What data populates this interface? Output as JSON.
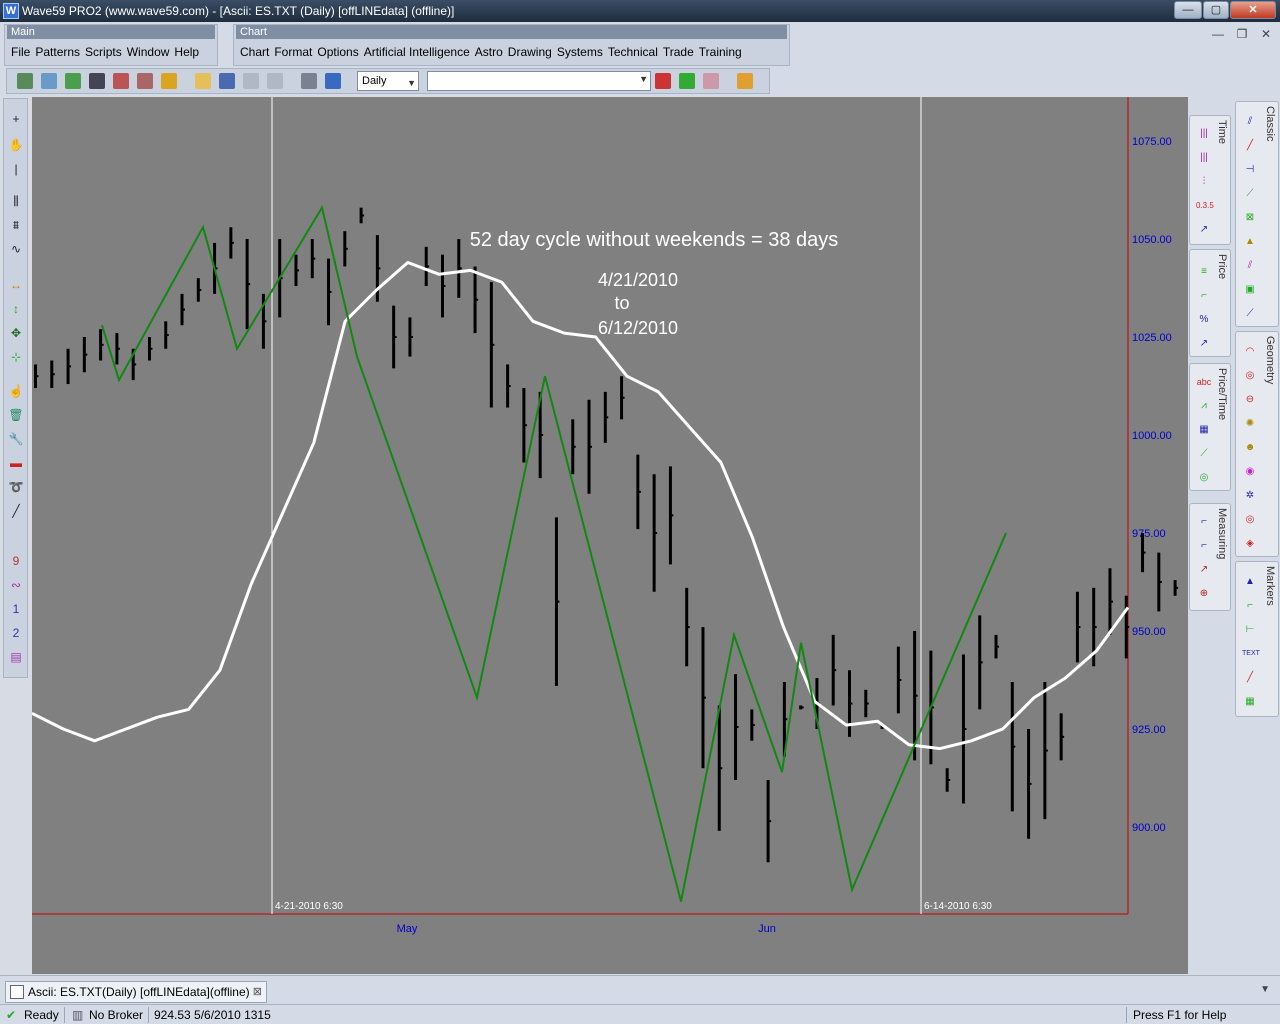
{
  "window": {
    "title": "Wave59 PRO2 (www.wave59.com) - [Ascii: ES.TXT (Daily) [offLINEdata] (offline)]",
    "app_icon": "W",
    "minimize": "—",
    "maximize": "▢",
    "close": "✕"
  },
  "menus": {
    "main": {
      "title": "Main",
      "items": [
        "File",
        "Patterns",
        "Scripts",
        "Window",
        "Help"
      ]
    },
    "chart": {
      "title": "Chart",
      "items": [
        "Chart",
        "Format",
        "Options",
        "Artificial Intelligence",
        "Astro",
        "Drawing",
        "Systems",
        "Technical",
        "Trade",
        "Training"
      ]
    }
  },
  "mdi_controls": {
    "minimize": "—",
    "restore": "❐",
    "close": "✕"
  },
  "toolbar": {
    "timeframe": "Daily",
    "symbol": ""
  },
  "chart": {
    "annotation": "52 day cycle without weekends = 38 days",
    "date_from": "4/21/2010",
    "date_to_word": "to",
    "date_to": "6/12/2010",
    "vline1_label": "4-21-2010 6:30",
    "vline2_label": "6-14-2010 6:30",
    "month_labels": [
      "May",
      "Jun"
    ],
    "price_labels": [
      "1075.00",
      "1050.00",
      "1025.00",
      "1000.00",
      "975.00",
      "950.00",
      "925.00",
      "900.00"
    ],
    "colors": {
      "background": "#808080",
      "bars": "#000000",
      "zigzag": "#118811",
      "cycle_line": "#ffffff",
      "axis": "#cc0000",
      "price_text": "#0000cc"
    }
  },
  "chart_data": {
    "type": "ohlc",
    "title": "",
    "xlabel": "",
    "ylabel": "",
    "ylim": [
      880,
      1085
    ],
    "categories": [],
    "series": [
      {
        "values": [
          [
            1018,
            1012
          ],
          [
            1019,
            1012
          ],
          [
            1022,
            1013
          ],
          [
            1025,
            1016
          ],
          [
            1027,
            1019
          ],
          [
            1026,
            1018
          ],
          [
            1022,
            1014
          ],
          [
            1025,
            1019
          ],
          [
            1029,
            1022
          ],
          [
            1036,
            1028
          ],
          [
            1040,
            1034
          ],
          [
            1049,
            1036
          ],
          [
            1053,
            1045
          ],
          [
            1050,
            1027
          ],
          [
            1036,
            1022
          ],
          [
            1050,
            1030
          ],
          [
            1046,
            1038
          ],
          [
            1050,
            1040
          ],
          [
            1045,
            1028
          ],
          [
            1052,
            1043
          ],
          [
            1058,
            1054
          ],
          [
            1051,
            1034
          ],
          [
            1033,
            1017
          ],
          [
            1030,
            1020
          ],
          [
            1048,
            1038
          ],
          [
            1046,
            1030
          ],
          [
            1050,
            1035
          ],
          [
            1043,
            1026
          ],
          [
            1039,
            1007
          ],
          [
            1018,
            1007
          ],
          [
            1012,
            993
          ],
          [
            1011,
            989
          ],
          [
            979,
            936
          ],
          [
            1004,
            990
          ],
          [
            1009,
            985
          ],
          [
            1011,
            998
          ],
          [
            1015,
            1004
          ],
          [
            995,
            976
          ],
          [
            990,
            960
          ],
          [
            992,
            967
          ],
          [
            961,
            941
          ],
          [
            951,
            915
          ],
          [
            931,
            899
          ],
          [
            939,
            912
          ],
          [
            930,
            922
          ],
          [
            912,
            891
          ],
          [
            937,
            918
          ],
          [
            931,
            930
          ],
          [
            938,
            925
          ],
          [
            949,
            931
          ],
          [
            940,
            923
          ],
          [
            935,
            928
          ],
          [
            926,
            925
          ],
          [
            946,
            929
          ],
          [
            950,
            917
          ],
          [
            945,
            916
          ],
          [
            915,
            909
          ],
          [
            944,
            906
          ],
          [
            954,
            930
          ],
          [
            949,
            943
          ],
          [
            937,
            904
          ],
          [
            925,
            897
          ],
          [
            937,
            902
          ],
          [
            929,
            917
          ],
          [
            960,
            942
          ],
          [
            961,
            941
          ],
          [
            966,
            949
          ],
          [
            959,
            943
          ],
          [
            975,
            965
          ],
          [
            970,
            955
          ],
          [
            963,
            959
          ],
          [
            955,
            946
          ],
          [
            944,
            926
          ],
          [
            929,
            914
          ],
          [
            924,
            909
          ],
          [
            928,
            915
          ],
          [
            906,
            888
          ],
          [
            890,
            878
          ]
        ]
      }
    ],
    "zigzag": [
      1028,
      1014,
      1053,
      1022,
      1058,
      1020,
      933,
      1015,
      881,
      949,
      914,
      947,
      884,
      975
    ],
    "cycle_overlay": [
      929,
      925,
      922,
      925,
      928,
      930,
      940,
      962,
      980,
      998,
      1029,
      1037,
      1044,
      1041,
      1042,
      1039,
      1029,
      1026,
      1025,
      1015,
      1011,
      1002,
      993,
      974,
      951,
      932,
      926,
      927,
      921,
      920,
      922,
      925,
      933,
      938,
      945,
      956
    ],
    "annotations": [
      "52 day cycle without weekends = 38 days",
      "4/21/2010",
      "to",
      "6/12/2010",
      "4-21-2010 6:30",
      "6-14-2010 6:30"
    ]
  },
  "right_panels": {
    "time": "Time",
    "price": "Price",
    "price_time": "Price/Time",
    "measuring": "Measuring",
    "classic": "Classic",
    "geometry": "Geometry",
    "markers": "Markers",
    "text_icon": "TEXT",
    "abc_icon": "abc",
    "percent_icon": "%",
    "fib_icon": "0.3.5"
  },
  "doc_tab": {
    "label": "Ascii: ES.TXT(Daily) [offLINEdata](offline)",
    "close": "⊠"
  },
  "status": {
    "ready": "Ready",
    "broker": "No Broker",
    "readout": "924.53  5/6/2010  1315",
    "help": "Press F1 for Help"
  }
}
